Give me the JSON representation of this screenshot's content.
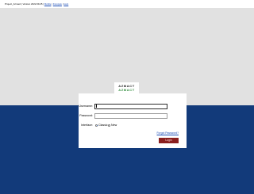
{
  "topbar": {
    "title": "Project_Azmact | Version 2022.09.25 |",
    "links": [
      "Mobile",
      "Français",
      "Help"
    ]
  },
  "logo": {
    "top_text": "AZMACT",
    "bottom_text": "AZMACT",
    "top_color": "#1a1a1a",
    "bottom_color": "#2e8b3a"
  },
  "login": {
    "username_label": "Username:",
    "username_value": "",
    "password_label": "Password:",
    "password_value": "",
    "interface_label": "Interface:",
    "interface_options": [
      "Classic",
      "New"
    ],
    "interface_selected": "Classic",
    "forgot_password": "Forgot Password?",
    "login_button": "Login"
  },
  "colors": {
    "background_top": "#e1e1e1",
    "background_bottom": "#123a7a",
    "button": "#8a1f1f"
  }
}
